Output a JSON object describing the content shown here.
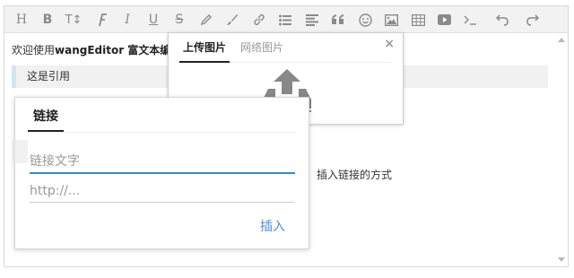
{
  "toolbar": {
    "icons": [
      "header-icon",
      "bold-icon",
      "font-size-icon",
      "font-name-icon",
      "italic-icon",
      "underline-icon",
      "strikethrough-icon",
      "text-color-icon",
      "background-color-icon",
      "link-icon",
      "list-icon",
      "justify-icon",
      "quote-icon",
      "emoticon-icon",
      "image-icon",
      "table-icon",
      "video-icon",
      "code-icon",
      "undo-icon",
      "redo-icon"
    ],
    "header": "H",
    "bold": "B",
    "fontsize": "T↕",
    "italic": "I",
    "underline": "U",
    "strike": "S"
  },
  "content": {
    "line1_prefix": "欢迎使用",
    "line1_bold": "wangEditor 富文本编",
    "quote": "这是引用",
    "line3": "插入链接的方式"
  },
  "image_panel": {
    "tab_upload": "上传图片",
    "tab_network": "网络图片",
    "close": "×"
  },
  "link_panel": {
    "tab": "链接",
    "text_placeholder": "链接文字",
    "url_placeholder": "http://...",
    "insert": "插入"
  },
  "colors": {
    "accent": "#2f8bd0",
    "insert_text": "#4a8fd6",
    "toolbar_bg": "#f2f2f2",
    "icon": "#8a8a8a",
    "quote_border": "#d0e5f2"
  }
}
